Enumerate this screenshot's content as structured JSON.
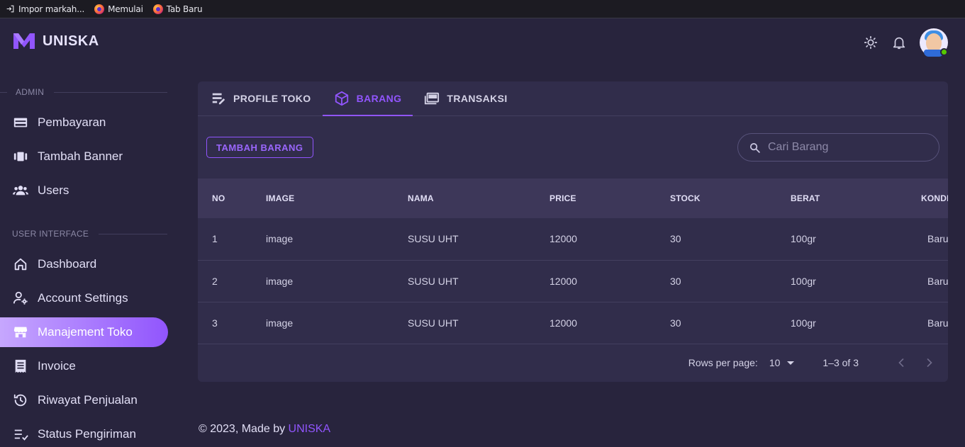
{
  "bookmarks": [
    {
      "label": "Impor markah...",
      "icon": "import-icon"
    },
    {
      "label": "Memulai",
      "icon": "firefox-icon"
    },
    {
      "label": "Tab Baru",
      "icon": "firefox-icon"
    }
  ],
  "brand": {
    "name": "UNISKA",
    "accent": "#9155fd"
  },
  "sidebar": {
    "sections": [
      {
        "title": "ADMIN",
        "items": [
          {
            "label": "Pembayaran",
            "icon": "credit-card-icon"
          },
          {
            "label": "Tambah Banner",
            "icon": "carousel-icon"
          },
          {
            "label": "Users",
            "icon": "users-icon"
          }
        ]
      },
      {
        "title": "USER INTERFACE",
        "items": [
          {
            "label": "Dashboard",
            "icon": "home-icon"
          },
          {
            "label": "Account Settings",
            "icon": "account-cog-icon"
          },
          {
            "label": "Manajement Toko",
            "icon": "store-icon",
            "active": true
          },
          {
            "label": "Invoice",
            "icon": "invoice-icon"
          },
          {
            "label": "Riwayat Penjualan",
            "icon": "history-icon"
          },
          {
            "label": "Status Pengiriman",
            "icon": "checklist-icon"
          }
        ]
      }
    ]
  },
  "tabs": [
    {
      "label": "PROFILE TOKO",
      "icon": "edit-list-icon"
    },
    {
      "label": "BARANG",
      "icon": "cube-icon",
      "active": true
    },
    {
      "label": "TRANSAKSI",
      "icon": "cards-icon"
    }
  ],
  "toolbar": {
    "add_label": "TAMBAH BARANG",
    "search_placeholder": "Cari Barang",
    "search_value": ""
  },
  "table": {
    "columns": [
      "NO",
      "IMAGE",
      "NAMA",
      "PRICE",
      "STOCK",
      "BERAT",
      "KONDI"
    ],
    "rows": [
      [
        "1",
        "image",
        "SUSU UHT",
        "12000",
        "30",
        "100gr",
        "Baru"
      ],
      [
        "2",
        "image",
        "SUSU UHT",
        "12000",
        "30",
        "100gr",
        "Baru"
      ],
      [
        "3",
        "image",
        "SUSU UHT",
        "12000",
        "30",
        "100gr",
        "Baru"
      ]
    ]
  },
  "pagination": {
    "rows_per_page_label": "Rows per page:",
    "rows_per_page": "10",
    "range": "1–3 of 3"
  },
  "footer": {
    "prefix": "© 2023, Made by ",
    "link": "UNISKA"
  }
}
